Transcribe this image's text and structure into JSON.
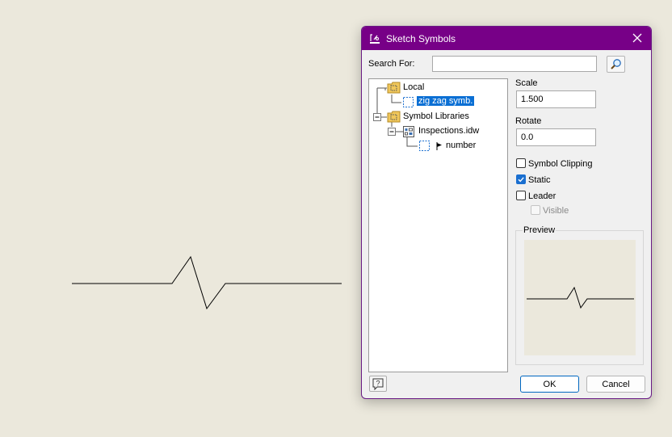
{
  "dialog": {
    "title": "Sketch Symbols",
    "title_icon": "sketch-symbols-icon",
    "close_icon": "close-icon",
    "accent_color": "#770087"
  },
  "search": {
    "label": "Search For:",
    "value": "",
    "button_icon": "magnifier-icon"
  },
  "tree": {
    "items": [
      {
        "label": "Local",
        "icon": "folder-icon"
      },
      {
        "label": "zig zag symb.",
        "icon": "symbol-icon",
        "selected": true
      },
      {
        "label": "Symbol Libraries",
        "icon": "folder-icon",
        "expander": "minus"
      },
      {
        "label": "Inspections.idw",
        "icon": "drawing-file-icon",
        "expander": "minus"
      },
      {
        "label": "number",
        "icon": "symbol-icon",
        "prefix_icon": "flag-icon"
      }
    ]
  },
  "properties": {
    "scale_label": "Scale",
    "scale_value": "1.500",
    "rotate_label": "Rotate",
    "rotate_value": "0.0"
  },
  "options": {
    "symbol_clipping": {
      "label": "Symbol Clipping",
      "checked": false
    },
    "static": {
      "label": "Static",
      "checked": true
    },
    "leader": {
      "label": "Leader",
      "checked": false
    },
    "visible": {
      "label": "Visible",
      "checked": false,
      "disabled": true
    }
  },
  "preview": {
    "title": "Preview",
    "background": "#ebe8dc"
  },
  "footer": {
    "help_icon": "help-icon",
    "ok_label": "OK",
    "cancel_label": "Cancel"
  }
}
